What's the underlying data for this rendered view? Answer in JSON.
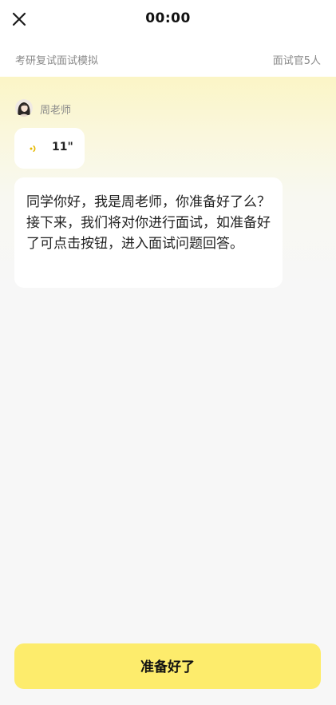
{
  "header": {
    "timer": "00:00",
    "close_icon": "close-icon"
  },
  "subheader": {
    "title": "考研复试面试模拟",
    "interviewer_count": "面试官5人"
  },
  "chat": {
    "teacher_name": "周老师",
    "avatar_icon": "avatar",
    "voice": {
      "icon": "voice-wave-icon",
      "duration": "11\""
    },
    "message": "同学你好，我是周老师，你准备好了么？接下来，我们将对你进行面试，如准备好了可点击按钮，进入面试问题回答。"
  },
  "actions": {
    "ready_label": "准备好了"
  },
  "colors": {
    "accent": "#fdec6c",
    "voice_icon": "#e6b800",
    "header_gradient_top": "#fbf5c6",
    "background": "#f7f7f7",
    "muted_text": "#8a8a8a"
  }
}
